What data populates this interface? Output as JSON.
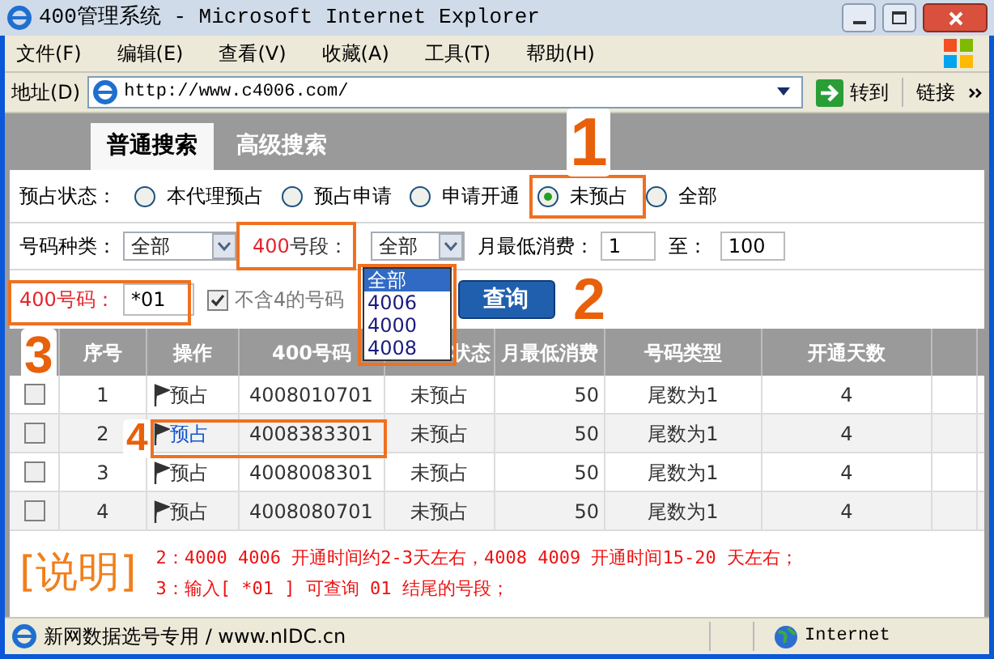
{
  "window": {
    "title": "400管理系统 - Microsoft Internet Explorer"
  },
  "menu": [
    "文件(F)",
    "编辑(E)",
    "查看(V)",
    "收藏(A)",
    "工具(T)",
    "帮助(H)"
  ],
  "address_bar": {
    "label": "地址(D)",
    "url": "http://www.c4006.com/",
    "go": "转到",
    "links": "链接"
  },
  "tabs": [
    {
      "label": "普通搜索",
      "selected": true
    },
    {
      "label": "高级搜索",
      "selected": false
    }
  ],
  "search": {
    "status_label": "预占状态：",
    "status_options": [
      {
        "label": "本代理预占",
        "selected": false
      },
      {
        "label": "预占申请",
        "selected": false
      },
      {
        "label": "申请开通",
        "selected": false
      },
      {
        "label": "未预占",
        "selected": true
      },
      {
        "label": "全部",
        "selected": false
      }
    ],
    "type_label": "号码种类：",
    "type_value": "全部",
    "segment_label_prefix": "400",
    "segment_label": "号段：",
    "segment_value": "全部",
    "segment_options": [
      {
        "label": "全部",
        "selected": true
      },
      {
        "label": "4006",
        "selected": false
      },
      {
        "label": "4000",
        "selected": false
      },
      {
        "label": "4008",
        "selected": false
      }
    ],
    "fee_label": "月最低消费：",
    "fee_min": "1",
    "fee_to": "至：",
    "fee_max": "100",
    "number_label": "400号码：",
    "number_value": "*01",
    "exclude4": {
      "label": "不含4的号码",
      "checked": true
    },
    "submit": "查询"
  },
  "table": {
    "columns": [
      "序号",
      "操作",
      "400号码",
      "状态",
      "月最低消费",
      "号码类型",
      "开通天数"
    ],
    "rows": [
      {
        "checked": false,
        "hovered": false,
        "cells": [
          "1",
          "预占",
          "4008010701",
          "未预占",
          "50",
          "尾数为1",
          "4"
        ]
      },
      {
        "checked": false,
        "hovered": true,
        "cells": [
          "2",
          "预占",
          "4008383301",
          "未预占",
          "50",
          "尾数为1",
          "4"
        ]
      },
      {
        "checked": false,
        "hovered": false,
        "cells": [
          "3",
          "预占",
          "4008008301",
          "未预占",
          "50",
          "尾数为1",
          "4"
        ]
      },
      {
        "checked": false,
        "hovered": false,
        "cells": [
          "4",
          "预占",
          "4008080701",
          "未预占",
          "50",
          "尾数为1",
          "4"
        ]
      }
    ]
  },
  "notes": {
    "title": "[说明]",
    "lines": [
      "2：4000 4006 开通时间约2-3天左右，4008 4009 开通时间15-20 天左右；",
      "3：输入[ *01 ] 可查询 01 结尾的号段；"
    ]
  },
  "status_bar": {
    "text": "新网数据选号专用 / www.nIDC.cn",
    "zone": "Internet"
  },
  "annotations": [
    "1",
    "2",
    "3",
    "4"
  ]
}
